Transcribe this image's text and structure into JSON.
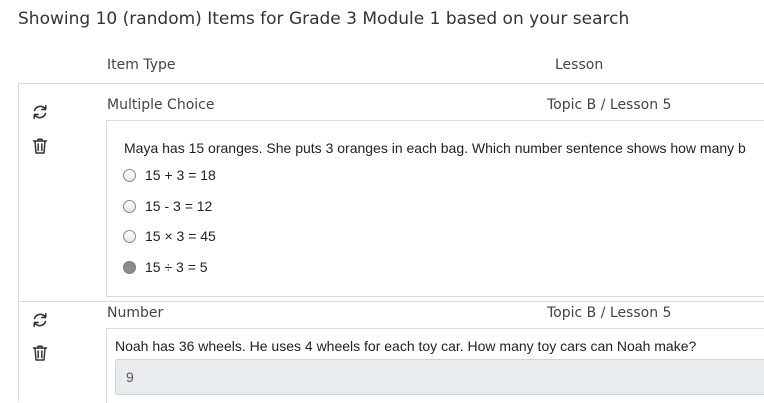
{
  "heading": "Showing 10 (random) Items for Grade 3 Module 1 based on your search",
  "columns": {
    "item_type": "Item Type",
    "lesson": "Lesson"
  },
  "icons": {
    "refresh": "refresh-icon",
    "delete": "trash-icon"
  },
  "items": [
    {
      "type": "Multiple Choice",
      "lesson": "Topic B / Lesson 5",
      "question": "Maya has 15 oranges. She puts 3 oranges in each bag. Which number sentence shows how many b",
      "options": [
        {
          "label": "15 + 3 = 18",
          "selected": false
        },
        {
          "label": "15 - 3 = 12",
          "selected": false
        },
        {
          "label": "15 × 3 = 45",
          "selected": false
        },
        {
          "label": "15 ÷ 3 = 5",
          "selected": true
        }
      ]
    },
    {
      "type": "Number",
      "lesson": "Topic B / Lesson 5",
      "question": "Noah has 36 wheels. He uses 4 wheels for each toy car. How many toy cars can Noah make?",
      "answer": "9"
    }
  ]
}
